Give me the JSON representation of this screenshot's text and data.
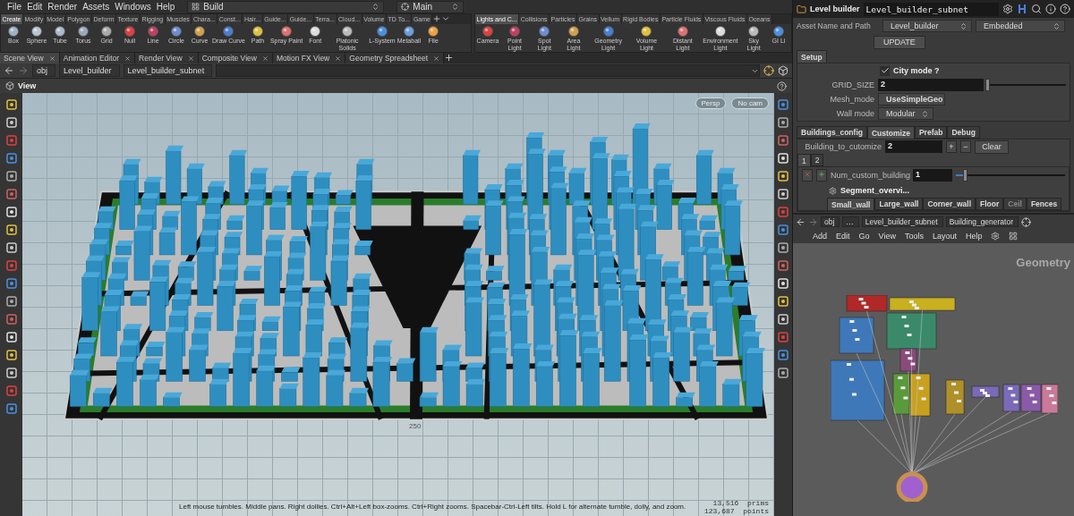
{
  "menu": [
    "File",
    "Edit",
    "Render",
    "Assets",
    "Windows",
    "Help"
  ],
  "desk": {
    "label": "Build"
  },
  "pane_layout": {
    "label": "Main"
  },
  "shelves": [
    {
      "tabs": [
        {
          "label": "Create",
          "selected": true
        },
        {
          "label": "Modify",
          "selected": false
        },
        {
          "label": "Model",
          "selected": false
        },
        {
          "label": "Polygon",
          "selected": false
        },
        {
          "label": "Deform",
          "selected": false
        },
        {
          "label": "Texture",
          "selected": false
        },
        {
          "label": "Rigging",
          "selected": false
        },
        {
          "label": "Muscles",
          "selected": false
        },
        {
          "label": "Chara...",
          "selected": false
        },
        {
          "label": "Const...",
          "selected": false
        },
        {
          "label": "Hair...",
          "selected": false
        },
        {
          "label": "Guide...",
          "selected": false
        },
        {
          "label": "Guide...",
          "selected": false
        },
        {
          "label": "Terra...",
          "selected": false
        },
        {
          "label": "Cloud...",
          "selected": false
        },
        {
          "label": "Volume",
          "selected": false
        },
        {
          "label": "TD To...",
          "selected": false
        },
        {
          "label": "Game",
          "selected": false
        }
      ],
      "tools": [
        "Box",
        "Sphere",
        "Tube",
        "Torus",
        "Grid",
        "Null",
        "Line",
        "Circle",
        "Curve",
        "Draw Curve",
        "Path",
        "Spray Paint",
        "Font",
        "Platonic Solids",
        "L-System",
        "Metaball",
        "File"
      ]
    },
    {
      "tabs": [
        {
          "label": "Lights and C...",
          "selected": true
        },
        {
          "label": "Collisions",
          "selected": false
        },
        {
          "label": "Particles",
          "selected": false
        },
        {
          "label": "Grains",
          "selected": false
        },
        {
          "label": "Vellum",
          "selected": false
        },
        {
          "label": "Rigid Bodies",
          "selected": false
        },
        {
          "label": "Particle Fluids",
          "selected": false
        },
        {
          "label": "Viscous Fluids",
          "selected": false
        },
        {
          "label": "Oceans",
          "selected": false
        }
      ],
      "tools": [
        "Camera",
        "Point Light",
        "Spot Light",
        "Area Light",
        "Geometry Light",
        "Volume Light",
        "Distant Light",
        "Environment Light",
        "Sky Light",
        "GI Li"
      ]
    }
  ],
  "pane_tabs": [
    {
      "label": "Scene View",
      "selected": true
    },
    {
      "label": "Animation Editor",
      "selected": false
    },
    {
      "label": "Render View",
      "selected": false
    },
    {
      "label": "Composite View",
      "selected": false
    },
    {
      "label": "Motion FX View",
      "selected": false
    },
    {
      "label": "Geometry Spreadsheet",
      "selected": false
    }
  ],
  "path": [
    "obj",
    "Level_builder",
    "Level_builder_subnet"
  ],
  "viewer": {
    "title": "View",
    "camera_buttons": [
      "Persp",
      "No cam"
    ],
    "axis_label": "250",
    "hint": "Left mouse tumbles. Middle pans. Right dollies. Ctrl+Alt+Left box-zooms. Ctrl+Right zooms. Spacebar-Ctrl-Left tilts. Hold L for alternate tumble, dolly, and zoom.",
    "stats": [
      {
        "value": "13,516",
        "unit": "prims"
      },
      {
        "value": "123,687",
        "unit": "points"
      }
    ]
  },
  "params": {
    "node_type": "Level builder",
    "node_name": "Level_builder_subnet",
    "asset_label": "Asset Name and Path",
    "asset_name": "Level_builder",
    "asset_location": "Embedded",
    "update_button": "UPDATE",
    "folder_tabs": [
      {
        "label": "Setup",
        "selected": true
      }
    ],
    "city_mode": {
      "label": "City mode ?",
      "checked": true
    },
    "grid_size": {
      "label": "GRID_SIZE",
      "value": "2",
      "level": 0.0
    },
    "mesh_mode": {
      "label": "Mesh_mode",
      "value": "UseSimpleGeo"
    },
    "wall_mode": {
      "label": "Wall mode",
      "value": "Modular"
    },
    "config_tabs": [
      {
        "label": "Buildings_config",
        "selected": false
      },
      {
        "label": "Customize",
        "selected": true
      },
      {
        "label": "Prefab",
        "selected": false
      },
      {
        "label": "Debug",
        "selected": false
      }
    ],
    "building_to_customize": {
      "label": "Building_to_cutomize",
      "value": "2",
      "steppers": [
        "+",
        "−"
      ],
      "clear_button": "Clear"
    },
    "instance_tabs": [
      {
        "label": "1",
        "selected": true
      },
      {
        "label": "2",
        "selected": false
      }
    ],
    "num_custom_building": {
      "label": "Num_custom_building",
      "value": "1",
      "level": 0.08
    },
    "segment_label": "Segment_overvi...",
    "wall_tabs": [
      {
        "label": "Small_wall",
        "selected": true,
        "disabled": false
      },
      {
        "label": "Large_wall",
        "selected": false,
        "disabled": false
      },
      {
        "label": "Corner_wall",
        "selected": false,
        "disabled": false
      },
      {
        "label": "Floor",
        "selected": false,
        "disabled": false
      },
      {
        "label": "Ceil",
        "selected": false,
        "disabled": true
      },
      {
        "label": "Fences",
        "selected": false,
        "disabled": false
      }
    ]
  },
  "network": {
    "path": [
      "obj",
      "…",
      "Level_builder_subnet",
      "Building_generator"
    ],
    "menu": [
      "Add",
      "Edit",
      "Go",
      "View",
      "Tools",
      "Layout",
      "Help"
    ],
    "context": "Geometry"
  }
}
